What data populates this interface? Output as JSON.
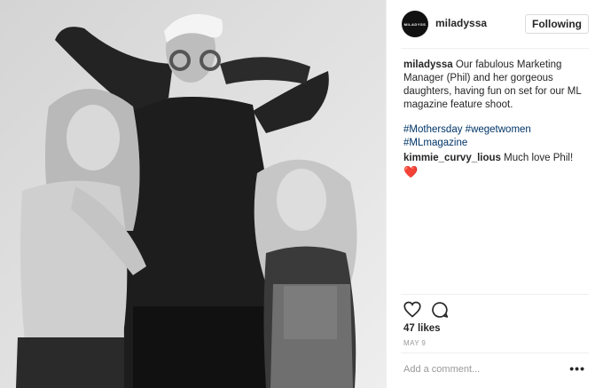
{
  "post": {
    "username": "miladyssa",
    "avatar_text": "MILADYSS",
    "follow_label": "Following",
    "caption": {
      "user": "miladyssa",
      "text": "Our fabulous Marketing Manager (Phil) and her gorgeous daughters, having fun on set for our ML magazine feature shoot."
    },
    "hashtags": "#Mothersday #wegetwomen #MLmagazine",
    "comments": [
      {
        "user": "kimmie_curvy_lious",
        "text": "Much love Phil!",
        "emoji": "❤️"
      }
    ],
    "likes": "47 likes",
    "date": "MAY 9",
    "add_comment_placeholder": "Add a comment...",
    "more_label": "•••",
    "icons": [
      "heart-outline-icon",
      "comment-icon",
      "more-icon"
    ]
  }
}
